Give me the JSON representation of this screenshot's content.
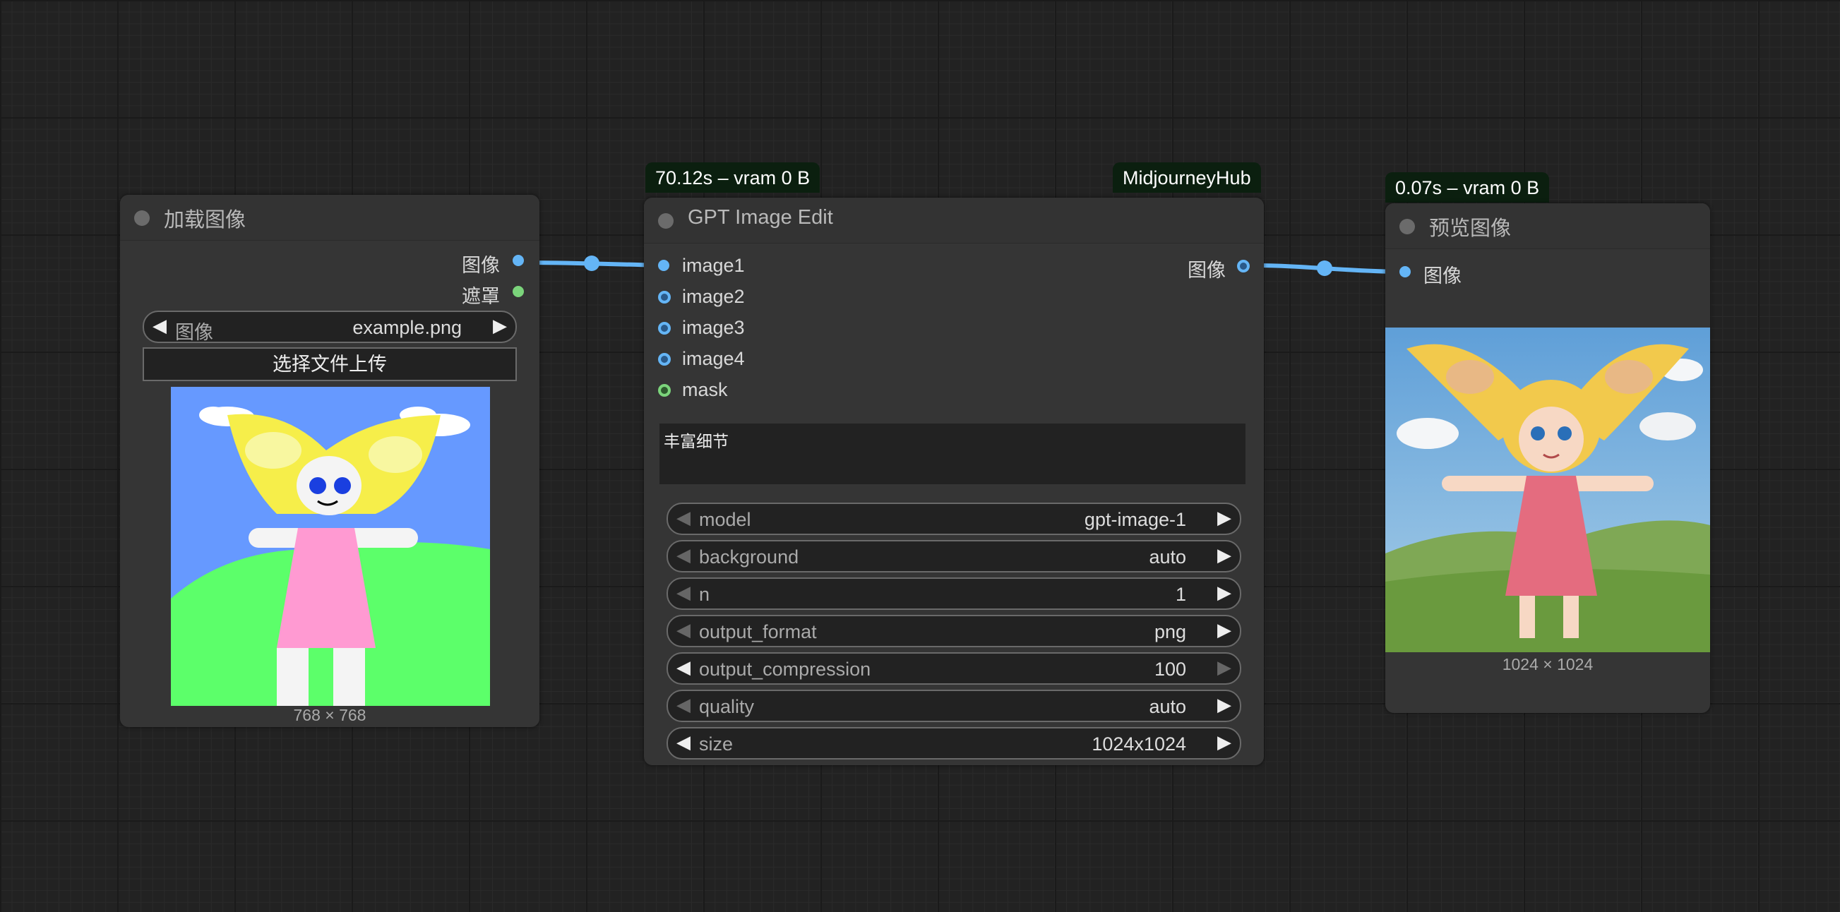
{
  "load_node": {
    "title": "加载图像",
    "out_image": "图像",
    "out_mask": "遮罩",
    "combo_label": "图像",
    "combo_value": "example.png",
    "upload_button": "选择文件上传",
    "image_size": "768 × 768"
  },
  "gpt_node": {
    "badge_time": "70.12s – vram 0 B",
    "badge_source": "MidjourneyHub",
    "title": "GPT Image Edit",
    "inputs": [
      "image1",
      "image2",
      "image3",
      "image4",
      "mask"
    ],
    "output": "图像",
    "prompt": "丰富细节",
    "widgets": [
      {
        "label": "model",
        "value": "gpt-image-1"
      },
      {
        "label": "background",
        "value": "auto"
      },
      {
        "label": "n",
        "value": "1"
      },
      {
        "label": "output_format",
        "value": "png"
      },
      {
        "label": "output_compression",
        "value": "100"
      },
      {
        "label": "quality",
        "value": "auto"
      },
      {
        "label": "size",
        "value": "1024x1024"
      }
    ]
  },
  "preview_node": {
    "badge_time": "0.07s – vram 0 B",
    "title": "预览图像",
    "input": "图像",
    "image_size": "1024 × 1024"
  },
  "colors": {
    "link": "#64b5f6",
    "mask_slot": "#7bd47b",
    "canvas": "#222222",
    "node_bg": "#353535",
    "badge_bg": "#0b1f0f"
  }
}
